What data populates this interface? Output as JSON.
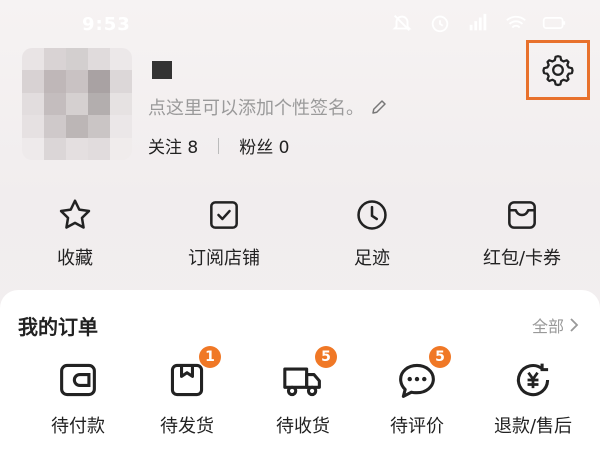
{
  "status_bar": {
    "time": "9:53"
  },
  "profile": {
    "signature": "点这里可以添加个性签名。",
    "follow_label": "关注",
    "follow_count": "8",
    "fans_label": "粉丝",
    "fans_count": "0"
  },
  "quick_links": [
    {
      "label": "收藏",
      "icon": "star-icon"
    },
    {
      "label": "订阅店铺",
      "icon": "subscribe-store-icon"
    },
    {
      "label": "足迹",
      "icon": "clock-icon"
    },
    {
      "label": "红包/卡券",
      "icon": "coupon-icon"
    }
  ],
  "orders": {
    "title": "我的订单",
    "all_label": "全部",
    "items": [
      {
        "label": "待付款",
        "icon": "wallet-icon",
        "badge": ""
      },
      {
        "label": "待发货",
        "icon": "package-icon",
        "badge": "1"
      },
      {
        "label": "待收货",
        "icon": "truck-icon",
        "badge": "5"
      },
      {
        "label": "待评价",
        "icon": "comment-icon",
        "badge": "5"
      },
      {
        "label": "退款/售后",
        "icon": "refund-icon",
        "badge": ""
      }
    ]
  },
  "colors": {
    "accent": "#f07826",
    "highlight_box": "#e8712c"
  }
}
